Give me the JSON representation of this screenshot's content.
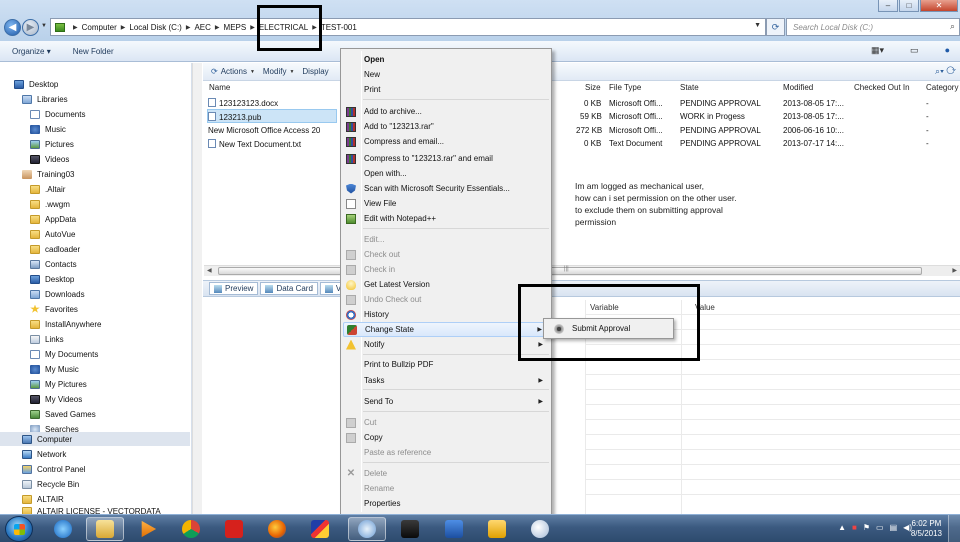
{
  "address": {
    "crumbs": [
      "Computer",
      "Local Disk (C:)",
      "AEC",
      "MEPS",
      "ELECTRICAL",
      "TEST-001"
    ],
    "search_placeholder": "Search Local Disk (C:)"
  },
  "toolbar": {
    "organize": "Organize",
    "new_folder": "New Folder"
  },
  "nav": {
    "items": [
      {
        "label": "Desktop",
        "icon": "desktop-icon"
      },
      {
        "label": "Libraries",
        "icon": "libraries-icon"
      },
      {
        "label": "Documents",
        "icon": "documents-icon"
      },
      {
        "label": "Music",
        "icon": "music-icon"
      },
      {
        "label": "Pictures",
        "icon": "pictures-icon"
      },
      {
        "label": "Videos",
        "icon": "videos-icon"
      },
      {
        "label": "Training03",
        "icon": "user-icon"
      },
      {
        "label": ".Altair",
        "icon": "folder-icon"
      },
      {
        "label": ".wwgm",
        "icon": "folder-icon"
      },
      {
        "label": "AppData",
        "icon": "folder-icon"
      },
      {
        "label": "AutoVue",
        "icon": "folder-icon"
      },
      {
        "label": "cadloader",
        "icon": "folder-icon"
      },
      {
        "label": "Contacts",
        "icon": "contacts-icon"
      },
      {
        "label": "Desktop",
        "icon": "desktop-icon"
      },
      {
        "label": "Downloads",
        "icon": "downloads-icon"
      },
      {
        "label": "Favorites",
        "icon": "favorites-icon"
      },
      {
        "label": "InstallAnywhere",
        "icon": "folder-icon"
      },
      {
        "label": "Links",
        "icon": "links-icon"
      },
      {
        "label": "My Documents",
        "icon": "documents-icon"
      },
      {
        "label": "My Music",
        "icon": "music-icon"
      },
      {
        "label": "My Pictures",
        "icon": "pictures-icon"
      },
      {
        "label": "My Videos",
        "icon": "videos-icon"
      },
      {
        "label": "Saved Games",
        "icon": "saved-games-icon"
      },
      {
        "label": "Searches",
        "icon": "searches-icon"
      },
      {
        "label": "Computer",
        "icon": "computer-icon"
      },
      {
        "label": "Network",
        "icon": "network-icon"
      },
      {
        "label": "Control Panel",
        "icon": "control-panel-icon"
      },
      {
        "label": "Recycle Bin",
        "icon": "recycle-bin-icon"
      },
      {
        "label": "ALTAIR",
        "icon": "folder-icon"
      },
      {
        "label": "ALTAIR LICENSE - VECTORDATA",
        "icon": "folder-icon"
      }
    ]
  },
  "content_toolbar": {
    "actions": "Actions",
    "modify": "Modify",
    "display": "Display"
  },
  "columns": {
    "name": "Name",
    "size": "Size",
    "file_type": "File Type",
    "state": "State",
    "modified": "Modified",
    "checked_out_in": "Checked Out In",
    "category": "Category"
  },
  "files": [
    {
      "name": "123123123.docx",
      "size": "0 KB",
      "type": "Microsoft Offi...",
      "state": "PENDING APPROVAL",
      "modified": "2013-08-05 17:...",
      "category": "-"
    },
    {
      "name": "123213.pub",
      "size": "59 KB",
      "type": "Microsoft Offi...",
      "state": "WORK in Progess",
      "modified": "2013-08-05 17:...",
      "category": "-"
    },
    {
      "name": "New Microsoft Office Access 20",
      "size": "272 KB",
      "type": "Microsoft Offi...",
      "state": "PENDING APPROVAL",
      "modified": "2006-06-16 10:...",
      "category": "-"
    },
    {
      "name": "New Text Document.txt",
      "size": "0 KB",
      "type": "Text Document",
      "state": "PENDING APPROVAL",
      "modified": "2013-07-17 14:...",
      "category": "-"
    }
  ],
  "note": {
    "line1": "Im am logged as mechanical user,",
    "line2": "how can i set permission on the other user.",
    "line3": "to exclude them on submitting approval",
    "line4": "permission"
  },
  "bottom_tabs": {
    "preview": "Preview",
    "data_card": "Data Card",
    "version": "Ve"
  },
  "var_grid": {
    "variable": "Variable",
    "value": "Value"
  },
  "context_menu": {
    "open": "Open",
    "new": "New",
    "print": "Print",
    "add_to_archive": "Add to archive...",
    "add_to_rar": "Add to \"123213.rar\"",
    "compress_email": "Compress and email...",
    "compress_rar_email": "Compress to \"123213.rar\" and email",
    "open_with": "Open with...",
    "scan": "Scan with Microsoft Security Essentials...",
    "view_file": "View File",
    "edit_notepad": "Edit with Notepad++",
    "edit": "Edit...",
    "check_out": "Check out",
    "check_in": "Check in",
    "get_latest": "Get Latest Version",
    "undo_checkout": "Undo Check out",
    "history": "History",
    "change_state": "Change State",
    "notify": "Notify",
    "print_bullzip": "Print to Bullzip PDF",
    "tasks": "Tasks",
    "send_to": "Send To",
    "cut": "Cut",
    "copy": "Copy",
    "paste_reference": "Paste as reference",
    "delete": "Delete",
    "rename": "Rename",
    "properties": "Properties"
  },
  "submenu": {
    "submit_approval": "Submit Approval"
  },
  "taskbar": {
    "time": "6:02 PM",
    "date": "8/5/2013"
  }
}
